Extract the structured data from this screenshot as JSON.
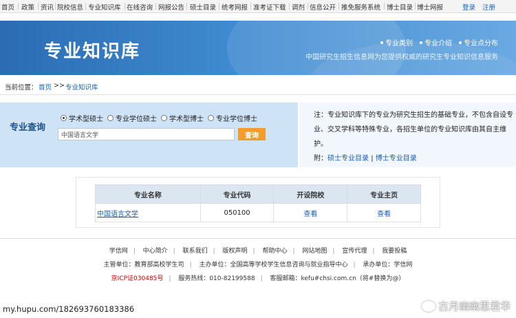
{
  "topnav": {
    "items": [
      "首页",
      "政策",
      "资讯",
      "院校信息",
      "专业知识库",
      "在线咨询",
      "网报公告",
      "硕士目录",
      "统考网报",
      "准考证下载",
      "调剂",
      "信息公开",
      "推免服务系统",
      "博士目录",
      "博士网报"
    ],
    "login": "登录",
    "register": "注册"
  },
  "banner": {
    "title": "专业知识库",
    "links": [
      "专业类别",
      "专业介绍",
      "专业点分布"
    ],
    "subtitle": "中国研究生招生信息网为您提供权威的研究生专业知识信息服务"
  },
  "breadcrumb": {
    "prefix": "当前位置：",
    "home": "首页",
    "arrow": ">>",
    "current": "专业知识库"
  },
  "search": {
    "label": "专业查询",
    "options": [
      "学术型硕士",
      "专业学位硕士",
      "学术型博士",
      "专业学位博士"
    ],
    "selected_index": 0,
    "input_value": "中国语言文学",
    "button": "查询"
  },
  "note": {
    "text": "注：专业知识库下的专业为研究生招生的基础专业，不包含自设专业、交叉学科等特殊专业，各招生单位的专业知识库由其自主维护。",
    "attach_label": "附：",
    "link1": "硕士专业目录",
    "divider": "|",
    "link2": "博士专业目录"
  },
  "table": {
    "headers": [
      "专业名称",
      "专业代码",
      "开设院校",
      "专业主页"
    ],
    "rows": [
      {
        "name": "中国语言文学",
        "code": "050100",
        "schools": "查看",
        "homepage": "查看"
      }
    ]
  },
  "footer": {
    "links": [
      "学信网",
      "中心简介",
      "联系我们",
      "版权声明",
      "帮助中心",
      "网站地图",
      "宣传代理",
      "我要投稿"
    ],
    "line2": [
      "主管单位：教育部高校学生司",
      "主办单位：全国高等学校学生信息咨询与就业指导中心",
      "承办单位：学信网"
    ],
    "icp": "京ICP证030485号",
    "hotline": "服务热线：010-82199588",
    "email": "客服邮箱：kefu#chsi.com.cn（将#替换为@）"
  },
  "watermark": {
    "left": "my.hupu.com/182693760183386",
    "right": "古月幽幽思君华"
  },
  "colors": {
    "banner": "#3f8ad0",
    "link": "#1a5fb4",
    "button": "#f29c2b",
    "panel": "#cfe3f7"
  }
}
